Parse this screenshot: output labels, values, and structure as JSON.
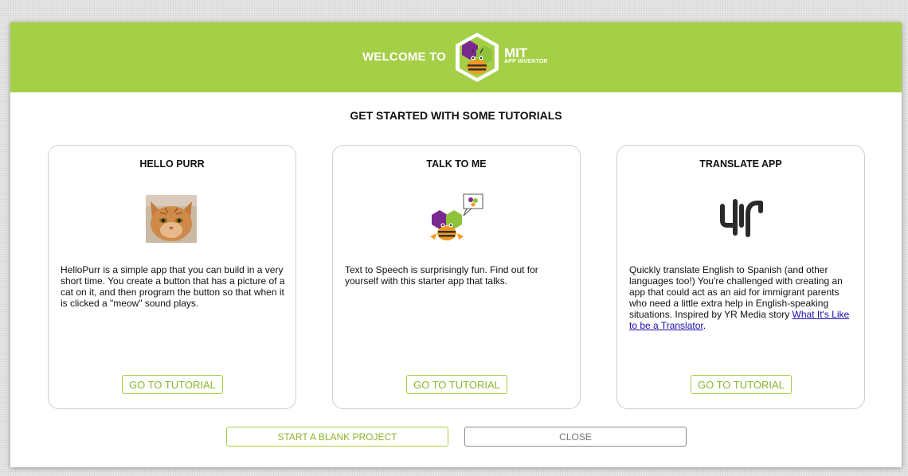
{
  "header": {
    "welcome": "WELCOME TO",
    "logo_mit": "MIT",
    "logo_sub": "APP INVENTOR",
    "background_color": "#a5cf47"
  },
  "subtitle": "GET STARTED WITH SOME TUTORIALS",
  "cards": [
    {
      "title": "HELLO PURR",
      "icon": "cat-photo",
      "description": "HelloPurr is a simple app that you can build in a very short time. You create a button that has a picture of a cat on it, and then program the button so that when it is clicked a \"meow\" sound plays.",
      "button": "GO TO TUTORIAL"
    },
    {
      "title": "TALK TO ME",
      "icon": "talking-bee-icon",
      "description": "Text to Speech is surprisingly fun. Find out for yourself with this starter app that talks.",
      "button": "GO TO TUTORIAL"
    },
    {
      "title": "TRANSLATE APP",
      "icon": "yr-media-logo",
      "description_prefix": "Quickly translate English to Spanish (and other languages too!) You're challenged with creating an app that could act as an aid for immigrant parents who need a little extra help in English-speaking situations. Inspired by YR Media story ",
      "description_link": "What It's Like to be a Translator",
      "description_suffix": ".",
      "button": "GO TO TUTORIAL"
    }
  ],
  "footer": {
    "start_blank": "START A BLANK PROJECT",
    "close": "CLOSE"
  },
  "colors": {
    "accent": "#a5cf47",
    "accent_text": "#8ab52e",
    "link": "#1a0dab"
  }
}
